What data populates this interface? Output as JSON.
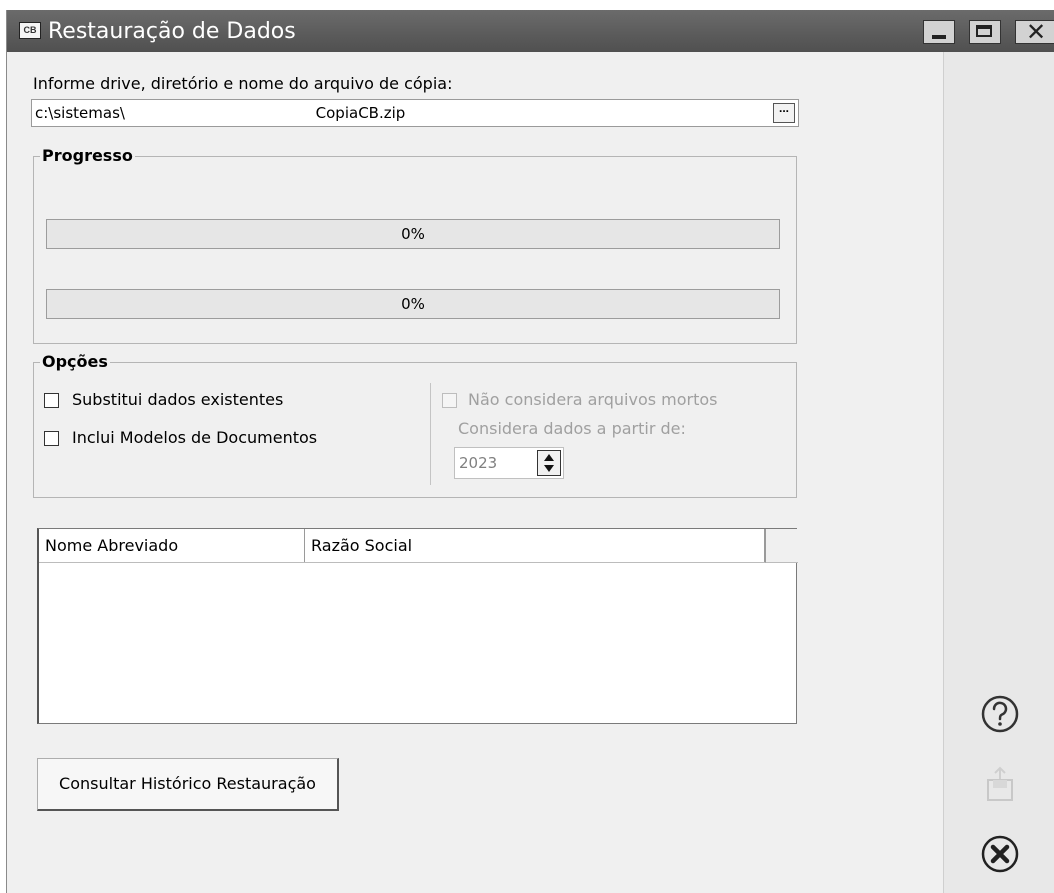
{
  "window": {
    "title": "Restauração de Dados",
    "icon_text": "CB"
  },
  "file": {
    "label": "Informe drive, diretório e nome do arquivo de cópia:",
    "value": "c:\\sistemas\\                                        CopiaCB.zip",
    "browse_label": "..."
  },
  "progress": {
    "title": "Progresso",
    "bars": [
      {
        "text": "0%",
        "value": 0
      },
      {
        "text": "0%",
        "value": 0
      }
    ]
  },
  "options": {
    "title": "Opções",
    "substitui": {
      "label": "Substitui dados existentes",
      "checked": false
    },
    "inclui": {
      "label": "Inclui Modelos de Documentos",
      "checked": false
    },
    "nao_considera": {
      "label": "Não considera arquivos mortos",
      "checked": false,
      "enabled": false
    },
    "considera_label": "Considera dados a partir de:",
    "year": "2023"
  },
  "table": {
    "columns": [
      "Nome Abreviado",
      "Razão Social"
    ],
    "rows": []
  },
  "buttons": {
    "historico": "Consultar Histórico Restauração"
  },
  "side_icons": [
    "help-icon",
    "export-icon",
    "close-circle-icon"
  ],
  "colors": {
    "titlebar": "#5a5a5a",
    "window_bg": "#f0f0f0",
    "progress_fill": "#4caf50"
  }
}
